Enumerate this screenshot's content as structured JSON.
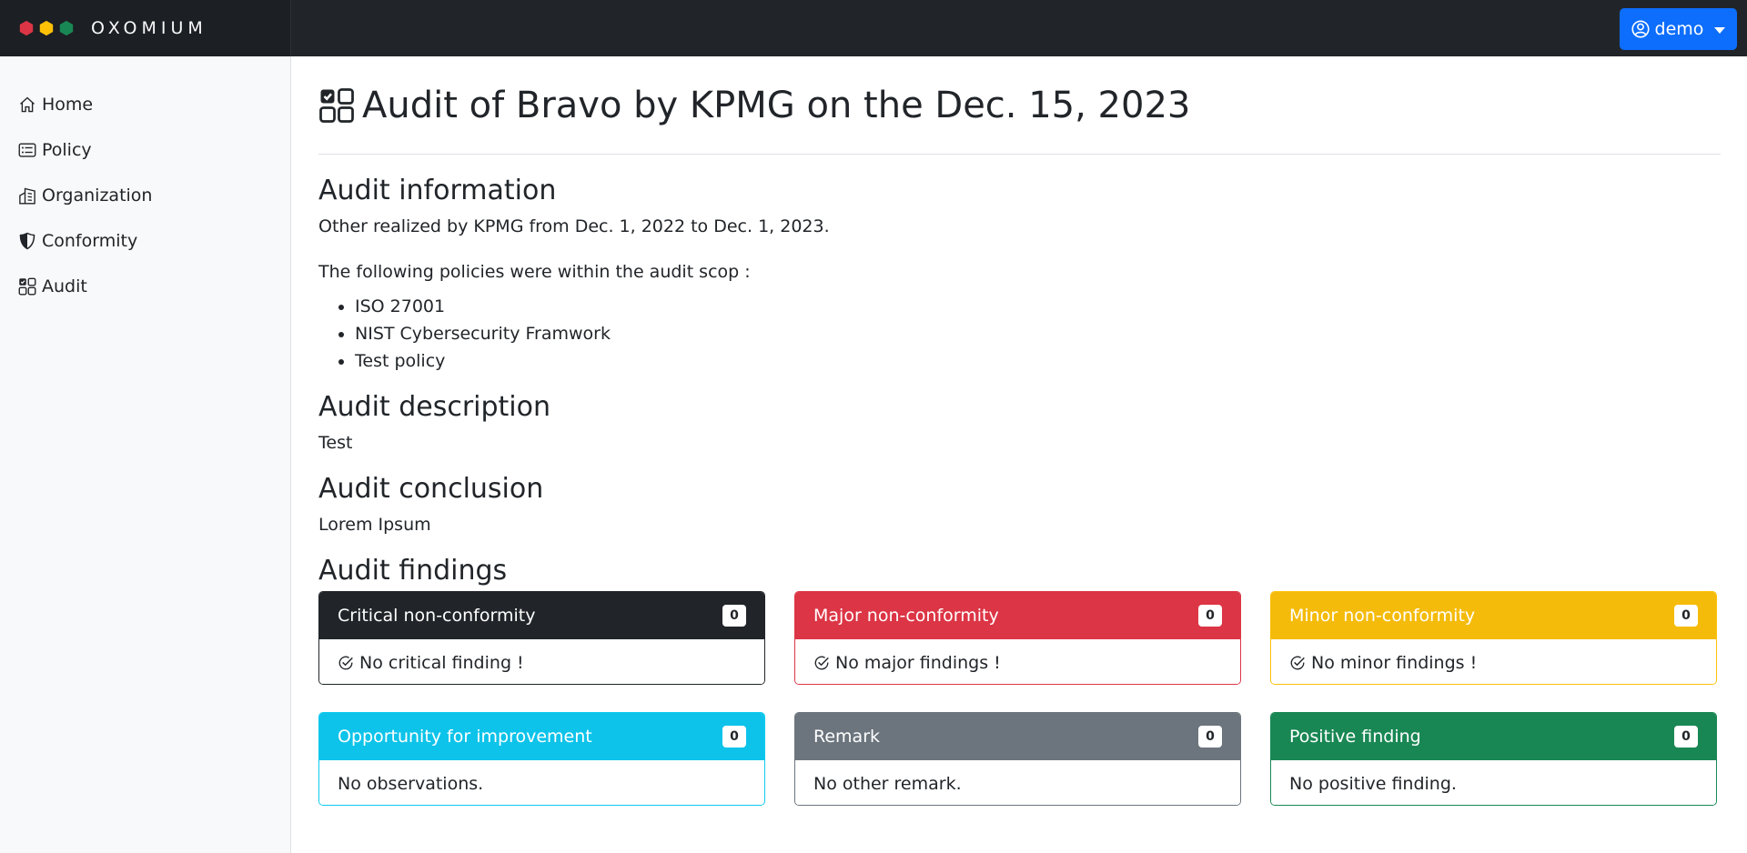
{
  "app": {
    "brand": "OXOMIUM",
    "user": "demo"
  },
  "colors": {
    "red": "#dc3545",
    "yellow": "#ffc107",
    "green": "#198754",
    "blue": "#0d6efd",
    "cyan": "#0dcaf0",
    "gray": "#6c757d",
    "dark": "#212529"
  },
  "sidebar": {
    "items": [
      {
        "label": "Home",
        "icon": "house-icon"
      },
      {
        "label": "Policy",
        "icon": "card-list-icon"
      },
      {
        "label": "Organization",
        "icon": "buildings-icon"
      },
      {
        "label": "Conformity",
        "icon": "shield-half-icon"
      },
      {
        "label": "Audit",
        "icon": "ui-checks-grid-icon"
      }
    ]
  },
  "main": {
    "title": "Audit of Bravo by KPMG on the Dec. 15, 2023",
    "info_heading": "Audit information",
    "info_text": "Other realized by KPMG from Dec. 1, 2022 to Dec. 1, 2023.",
    "scope_text": "The following policies were within the audit scop :",
    "policies": [
      "ISO 27001",
      "NIST Cybersecurity Framwork",
      "Test policy"
    ],
    "description_heading": "Audit description",
    "description_text": "Test",
    "conclusion_heading": "Audit conclusion",
    "conclusion_text": "Lorem Ipsum",
    "findings_heading": "Audit findings",
    "findings": [
      {
        "title": "Critical non-conformity",
        "count": "0",
        "body": "No critical finding !"
      },
      {
        "title": "Major non-conformity",
        "count": "0",
        "body": "No major findings !"
      },
      {
        "title": "Minor non-conformity",
        "count": "0",
        "body": "No minor findings !"
      },
      {
        "title": "Opportunity for improvement",
        "count": "0",
        "body": "No observations."
      },
      {
        "title": "Remark",
        "count": "0",
        "body": "No other remark."
      },
      {
        "title": "Positive finding",
        "count": "0",
        "body": "No positive finding."
      }
    ]
  }
}
